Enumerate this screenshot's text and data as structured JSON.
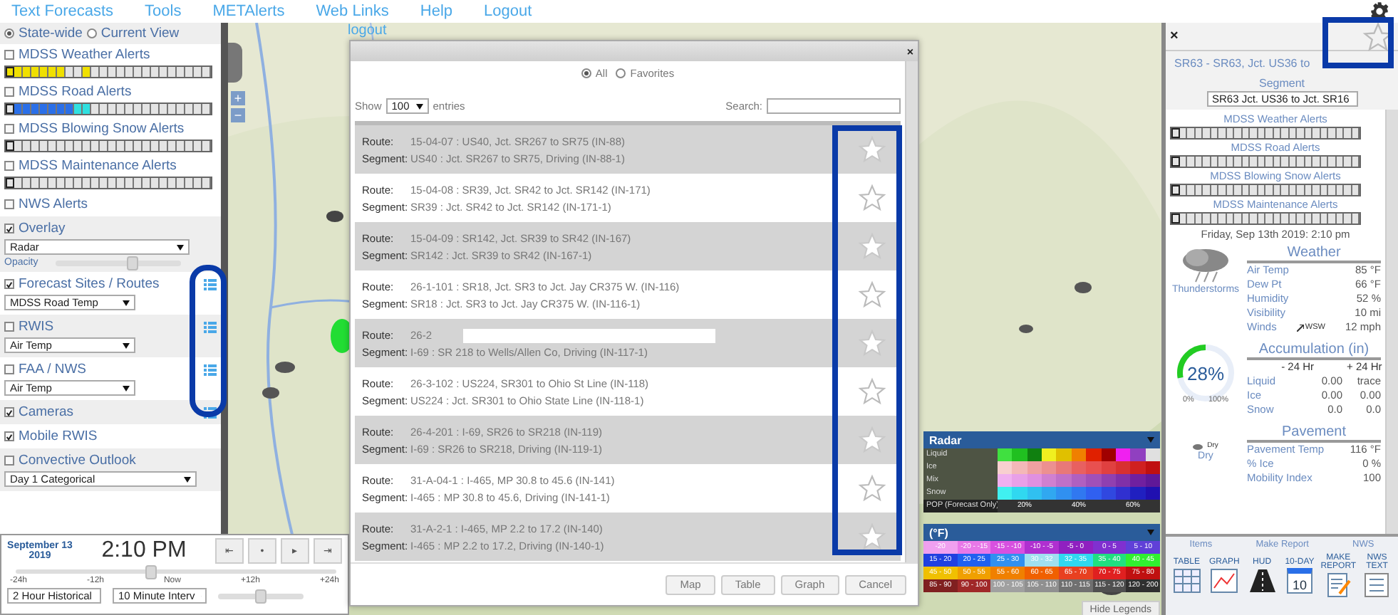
{
  "nav": {
    "links": [
      "Text Forecasts",
      "Tools",
      "METAlerts",
      "Web Links",
      "Help",
      "Logout"
    ]
  },
  "left_panel": {
    "scope": [
      {
        "label": "State-wide",
        "selected": true
      },
      {
        "label": "Current View",
        "selected": false
      }
    ],
    "alerts": [
      {
        "label": "MDSS Weather Alerts",
        "checked": false,
        "cells": [
          {
            "color": "#f0e000"
          },
          {
            "color": "#f0e000"
          },
          {
            "color": "#f0e000"
          },
          {
            "color": "#f0e000"
          },
          {
            "color": "#f0e000"
          },
          {
            "color": "#f0e000"
          },
          {
            "color": "#f0e000"
          },
          {
            "color": "#e4e4e4"
          },
          {
            "color": "#e4e4e4"
          },
          {
            "color": "#f0e000"
          },
          {
            "color": "#e4e4e4"
          },
          {
            "color": "#e4e4e4"
          },
          {
            "color": "#e4e4e4"
          },
          {
            "color": "#e4e4e4"
          },
          {
            "color": "#e4e4e4"
          },
          {
            "color": "#e4e4e4"
          },
          {
            "color": "#e4e4e4"
          },
          {
            "color": "#e4e4e4"
          },
          {
            "color": "#e4e4e4"
          },
          {
            "color": "#e4e4e4"
          },
          {
            "color": "#e4e4e4"
          },
          {
            "color": "#e4e4e4"
          },
          {
            "color": "#e4e4e4"
          },
          {
            "color": "#e4e4e4"
          }
        ]
      },
      {
        "label": "MDSS Road Alerts",
        "checked": false,
        "cells": [
          {
            "color": "#e4e4e4"
          },
          {
            "color": "#2a6fe8"
          },
          {
            "color": "#2a6fe8"
          },
          {
            "color": "#2a6fe8"
          },
          {
            "color": "#2a6fe8"
          },
          {
            "color": "#2a6fe8"
          },
          {
            "color": "#2a6fe8"
          },
          {
            "color": "#2a6fe8"
          },
          {
            "color": "#30e0e0"
          },
          {
            "color": "#30e0e0"
          },
          {
            "color": "#e4e4e4"
          },
          {
            "color": "#e4e4e4"
          },
          {
            "color": "#e4e4e4"
          },
          {
            "color": "#e4e4e4"
          },
          {
            "color": "#e4e4e4"
          },
          {
            "color": "#e4e4e4"
          },
          {
            "color": "#e4e4e4"
          },
          {
            "color": "#e4e4e4"
          },
          {
            "color": "#e4e4e4"
          },
          {
            "color": "#e4e4e4"
          },
          {
            "color": "#e4e4e4"
          },
          {
            "color": "#e4e4e4"
          },
          {
            "color": "#e4e4e4"
          },
          {
            "color": "#e4e4e4"
          }
        ]
      },
      {
        "label": "MDSS Blowing Snow Alerts",
        "checked": false,
        "cells": [
          {
            "color": "#e4e4e4"
          },
          {
            "color": "#e4e4e4"
          },
          {
            "color": "#e4e4e4"
          },
          {
            "color": "#e4e4e4"
          },
          {
            "color": "#e4e4e4"
          },
          {
            "color": "#e4e4e4"
          },
          {
            "color": "#e4e4e4"
          },
          {
            "color": "#e4e4e4"
          },
          {
            "color": "#e4e4e4"
          },
          {
            "color": "#e4e4e4"
          },
          {
            "color": "#e4e4e4"
          },
          {
            "color": "#e4e4e4"
          },
          {
            "color": "#e4e4e4"
          },
          {
            "color": "#e4e4e4"
          },
          {
            "color": "#e4e4e4"
          },
          {
            "color": "#e4e4e4"
          },
          {
            "color": "#e4e4e4"
          },
          {
            "color": "#e4e4e4"
          },
          {
            "color": "#e4e4e4"
          },
          {
            "color": "#e4e4e4"
          },
          {
            "color": "#e4e4e4"
          },
          {
            "color": "#e4e4e4"
          },
          {
            "color": "#e4e4e4"
          },
          {
            "color": "#e4e4e4"
          }
        ]
      },
      {
        "label": "MDSS Maintenance Alerts",
        "checked": false,
        "cells": [
          {
            "color": "#e4e4e4"
          },
          {
            "color": "#e4e4e4"
          },
          {
            "color": "#e4e4e4"
          },
          {
            "color": "#e4e4e4"
          },
          {
            "color": "#e4e4e4"
          },
          {
            "color": "#e4e4e4"
          },
          {
            "color": "#e4e4e4"
          },
          {
            "color": "#e4e4e4"
          },
          {
            "color": "#e4e4e4"
          },
          {
            "color": "#e4e4e4"
          },
          {
            "color": "#e4e4e4"
          },
          {
            "color": "#e4e4e4"
          },
          {
            "color": "#e4e4e4"
          },
          {
            "color": "#e4e4e4"
          },
          {
            "color": "#e4e4e4"
          },
          {
            "color": "#e4e4e4"
          },
          {
            "color": "#e4e4e4"
          },
          {
            "color": "#e4e4e4"
          },
          {
            "color": "#e4e4e4"
          },
          {
            "color": "#e4e4e4"
          },
          {
            "color": "#e4e4e4"
          },
          {
            "color": "#e4e4e4"
          },
          {
            "color": "#e4e4e4"
          },
          {
            "color": "#e4e4e4"
          }
        ]
      }
    ],
    "layers": [
      {
        "kind": "check",
        "label": "NWS Alerts",
        "checked": false,
        "list": false
      },
      {
        "kind": "overlay",
        "label": "Overlay",
        "checked": true,
        "select": "Radar",
        "opacity_label": "Opacity",
        "level": 0.62,
        "list": false
      },
      {
        "kind": "select",
        "label": "Forecast Sites / Routes",
        "checked": true,
        "select": "MDSS Road Temp",
        "list": true
      },
      {
        "kind": "select",
        "label": "RWIS",
        "checked": false,
        "select": "Air Temp",
        "list": true
      },
      {
        "kind": "select",
        "label": "FAA / NWS",
        "checked": false,
        "select": "Air Temp",
        "list": true
      },
      {
        "kind": "check",
        "label": "Cameras",
        "checked": true,
        "list": true
      },
      {
        "kind": "check",
        "label": "Mobile RWIS",
        "checked": true,
        "list": false
      },
      {
        "kind": "wide",
        "label": "Convective Outlook",
        "checked": false,
        "select": "Day 1 Categorical",
        "list": false
      }
    ]
  },
  "map": {
    "logout_text": "logout",
    "zoom": [
      "+",
      "−"
    ]
  },
  "time_panel": {
    "date": "September 13 2019",
    "time": "2:10 PM",
    "controls": [
      "⇤",
      "•",
      "▸",
      "⇥"
    ],
    "ticks": [
      "-24h",
      "-12h",
      "Now",
      "+12h",
      "+24h"
    ],
    "level": 0.42,
    "selects": [
      "2 Hour Historical",
      "10 Minute Interv"
    ],
    "speed": {
      "level": 0.5
    }
  },
  "modal": {
    "filters": [
      {
        "label": "All",
        "selected": true
      },
      {
        "label": "Favorites",
        "selected": false
      }
    ],
    "show_label": "Show",
    "page_size": "100",
    "entries_label": "entries",
    "search_label": "Search:",
    "rows": [
      {
        "route_label": "Route:",
        "route": "15-04-07 : US40, Jct. SR267 to SR75 (IN-88)",
        "segment_label": "Segment:",
        "segment": "US40 : Jct. SR267 to SR75, Driving (IN-88-1)",
        "favorite": true,
        "redacted": false
      },
      {
        "route_label": "Route:",
        "route": "15-04-08 : SR39, Jct. SR42 to Jct. SR142 (IN-171)",
        "segment_label": "Segment:",
        "segment": "SR39 : Jct. SR42 to Jct. SR142 (IN-171-1)",
        "favorite": false,
        "redacted": false
      },
      {
        "route_label": "Route:",
        "route": "15-04-09 : SR142, Jct. SR39 to SR42 (IN-167)",
        "segment_label": "Segment:",
        "segment": "SR142 : Jct. SR39 to SR42 (IN-167-1)",
        "favorite": true,
        "redacted": false
      },
      {
        "route_label": "Route:",
        "route": "26-1-101 : SR18, Jct. SR3 to Jct. Jay CR375 W. (IN-116)",
        "segment_label": "Segment:",
        "segment": "SR18 : Jct. SR3 to Jct. Jay CR375 W. (IN-116-1)",
        "favorite": false,
        "redacted": false
      },
      {
        "route_label": "Route:",
        "route": "26-2",
        "segment_label": "Segment:",
        "segment": "I-69 : SR 218 to Wells/Allen Co, Driving (IN-117-1)",
        "favorite": true,
        "redacted": true
      },
      {
        "route_label": "Route:",
        "route": "26-3-102 : US224, SR301 to Ohio St Line (IN-118)",
        "segment_label": "Segment:",
        "segment": "US224 : Jct. SR301 to Ohio State Line (IN-118-1)",
        "favorite": false,
        "redacted": false
      },
      {
        "route_label": "Route:",
        "route": "26-4-201 : I-69, SR26 to SR218 (IN-119)",
        "segment_label": "Segment:",
        "segment": "I-69 : SR26 to SR218, Driving (IN-119-1)",
        "favorite": true,
        "redacted": false
      },
      {
        "route_label": "Route:",
        "route": "31-A-04-1 : I-465, MP 30.8 to 45.6 (IN-141)",
        "segment_label": "Segment:",
        "segment": "I-465 : MP 30.8 to 45.6, Driving (IN-141-1)",
        "favorite": false,
        "redacted": false
      },
      {
        "route_label": "Route:",
        "route": "31-A-2-1 : I-465, MP 2.2 to 17.2 (IN-140)",
        "segment_label": "Segment:",
        "segment": "I-465 : MP 2.2 to 17.2, Driving (IN-140-1)",
        "favorite": true,
        "redacted": false
      }
    ],
    "buttons": [
      "Map",
      "Table",
      "Graph",
      "Cancel"
    ]
  },
  "legend": {
    "radar_title": "Radar",
    "radar_rows": [
      {
        "label": "Liquid",
        "colors": [
          {
            "color": "#40e040"
          },
          {
            "color": "#20c020"
          },
          {
            "color": "#108010"
          },
          {
            "color": "#f0f020"
          },
          {
            "color": "#e0c000"
          },
          {
            "color": "#f08000"
          },
          {
            "color": "#e02000"
          },
          {
            "color": "#a00000"
          },
          {
            "color": "#f020f0"
          },
          {
            "color": "#9040c0"
          },
          {
            "color": "#e0e0e0"
          }
        ]
      },
      {
        "label": "Ice",
        "colors": [
          {
            "color": "#f8d0d0"
          },
          {
            "color": "#f4b8b8"
          },
          {
            "color": "#f0a0a0"
          },
          {
            "color": "#ec9090"
          },
          {
            "color": "#e87878"
          },
          {
            "color": "#e86060"
          },
          {
            "color": "#e85050"
          },
          {
            "color": "#e04040"
          },
          {
            "color": "#d83030"
          },
          {
            "color": "#d02020"
          },
          {
            "color": "#c01010"
          }
        ]
      },
      {
        "label": "Mix",
        "colors": [
          {
            "color": "#f0b0f0"
          },
          {
            "color": "#e8a0e8"
          },
          {
            "color": "#e090e0"
          },
          {
            "color": "#d080d0"
          },
          {
            "color": "#c070c8"
          },
          {
            "color": "#b060c0"
          },
          {
            "color": "#a050b8"
          },
          {
            "color": "#9040b0"
          },
          {
            "color": "#8030a8"
          },
          {
            "color": "#7020a0"
          },
          {
            "color": "#601898"
          }
        ]
      },
      {
        "label": "Snow",
        "colors": [
          {
            "color": "#40f0f0"
          },
          {
            "color": "#30d8f0"
          },
          {
            "color": "#30c0f0"
          },
          {
            "color": "#30a8f0"
          },
          {
            "color": "#3090f0"
          },
          {
            "color": "#3078f0"
          },
          {
            "color": "#3060f0"
          },
          {
            "color": "#3048e0"
          },
          {
            "color": "#3030d0"
          },
          {
            "color": "#2020c0"
          },
          {
            "color": "#2010b0"
          }
        ]
      }
    ],
    "pop_label": "POP (Forecast Only)",
    "pop_values": [
      "20%",
      "40%",
      "60%"
    ],
    "temp_title": "(°F)",
    "temp_rows": [
      [
        {
          "label": "-20",
          "color": "#f0a0f0"
        },
        {
          "label": "-20 - -15",
          "color": "#e878e8"
        },
        {
          "label": "-15 - -10",
          "color": "#d850e0"
        },
        {
          "label": "-10 - -5",
          "color": "#b030d0"
        },
        {
          "label": "-5 - 0",
          "color": "#9020c0"
        },
        {
          "label": "0 - 5",
          "color": "#8030d0"
        },
        {
          "label": "5 - 10",
          "color": "#6040d8"
        }
      ],
      [
        {
          "label": "15 - 20",
          "color": "#2040e0"
        },
        {
          "label": "20 - 25",
          "color": "#2060f0"
        },
        {
          "label": "25 - 30",
          "color": "#3090f0"
        },
        {
          "label": "30 - 32",
          "color": "#a0e0f0"
        },
        {
          "label": "32 - 35",
          "color": "#30d8f0"
        },
        {
          "label": "35 - 40",
          "color": "#20e080"
        },
        {
          "label": "40 - 45",
          "color": "#30f030"
        }
      ],
      [
        {
          "label": "45 - 50",
          "color": "#f0c000"
        },
        {
          "label": "50 - 55",
          "color": "#f0a000"
        },
        {
          "label": "55 - 60",
          "color": "#f08000"
        },
        {
          "label": "60 - 65",
          "color": "#f06000"
        },
        {
          "label": "65 - 70",
          "color": "#e84020"
        },
        {
          "label": "70 - 75",
          "color": "#e02020"
        },
        {
          "label": "75 - 80",
          "color": "#c01010"
        }
      ],
      [
        {
          "label": "85 - 90",
          "color": "#802020"
        },
        {
          "label": "90 - 100",
          "color": "#a02828"
        },
        {
          "label": "100 - 105",
          "color": "#a0a0a0"
        },
        {
          "label": "105 - 110",
          "color": "#909090"
        },
        {
          "label": "110 - 115",
          "color": "#707070"
        },
        {
          "label": "115 - 120",
          "color": "#505050"
        },
        {
          "label": "120 - 200",
          "color": "#303030"
        }
      ]
    ],
    "hide_button": "Hide Legends"
  },
  "right_panel": {
    "close": "×",
    "favorite": false,
    "title": "SR63 - SR63, Jct. US36 to",
    "segment_label": "Segment",
    "segment_select": "SR63 Jct. US36 to Jct. SR16",
    "alerts": [
      {
        "label": "MDSS Weather Alerts",
        "cells": [
          {
            "color": "#e4e4e4"
          },
          {
            "color": "#e4e4e4"
          },
          {
            "color": "#e4e4e4"
          },
          {
            "color": "#e4e4e4"
          },
          {
            "color": "#e4e4e4"
          },
          {
            "color": "#e4e4e4"
          },
          {
            "color": "#e4e4e4"
          },
          {
            "color": "#e4e4e4"
          },
          {
            "color": "#e4e4e4"
          },
          {
            "color": "#e4e4e4"
          },
          {
            "color": "#e4e4e4"
          },
          {
            "color": "#e4e4e4"
          },
          {
            "color": "#e4e4e4"
          },
          {
            "color": "#e4e4e4"
          },
          {
            "color": "#e4e4e4"
          },
          {
            "color": "#e4e4e4"
          },
          {
            "color": "#e4e4e4"
          },
          {
            "color": "#e4e4e4"
          },
          {
            "color": "#e4e4e4"
          },
          {
            "color": "#e4e4e4"
          },
          {
            "color": "#e4e4e4"
          },
          {
            "color": "#e4e4e4"
          },
          {
            "color": "#e4e4e4"
          },
          {
            "color": "#e4e4e4"
          }
        ]
      },
      {
        "label": "MDSS Road Alerts",
        "cells": [
          {
            "color": "#e4e4e4"
          },
          {
            "color": "#e4e4e4"
          },
          {
            "color": "#e4e4e4"
          },
          {
            "color": "#e4e4e4"
          },
          {
            "color": "#e4e4e4"
          },
          {
            "color": "#e4e4e4"
          },
          {
            "color": "#e4e4e4"
          },
          {
            "color": "#e4e4e4"
          },
          {
            "color": "#e4e4e4"
          },
          {
            "color": "#e4e4e4"
          },
          {
            "color": "#e4e4e4"
          },
          {
            "color": "#e4e4e4"
          },
          {
            "color": "#e4e4e4"
          },
          {
            "color": "#e4e4e4"
          },
          {
            "color": "#e4e4e4"
          },
          {
            "color": "#e4e4e4"
          },
          {
            "color": "#e4e4e4"
          },
          {
            "color": "#e4e4e4"
          },
          {
            "color": "#e4e4e4"
          },
          {
            "color": "#e4e4e4"
          },
          {
            "color": "#e4e4e4"
          },
          {
            "color": "#e4e4e4"
          },
          {
            "color": "#e4e4e4"
          },
          {
            "color": "#e4e4e4"
          }
        ]
      },
      {
        "label": "MDSS Blowing Snow Alerts",
        "cells": [
          {
            "color": "#e4e4e4"
          },
          {
            "color": "#e4e4e4"
          },
          {
            "color": "#e4e4e4"
          },
          {
            "color": "#e4e4e4"
          },
          {
            "color": "#e4e4e4"
          },
          {
            "color": "#e4e4e4"
          },
          {
            "color": "#e4e4e4"
          },
          {
            "color": "#e4e4e4"
          },
          {
            "color": "#e4e4e4"
          },
          {
            "color": "#e4e4e4"
          },
          {
            "color": "#e4e4e4"
          },
          {
            "color": "#e4e4e4"
          },
          {
            "color": "#e4e4e4"
          },
          {
            "color": "#e4e4e4"
          },
          {
            "color": "#e4e4e4"
          },
          {
            "color": "#e4e4e4"
          },
          {
            "color": "#e4e4e4"
          },
          {
            "color": "#e4e4e4"
          },
          {
            "color": "#e4e4e4"
          },
          {
            "color": "#e4e4e4"
          },
          {
            "color": "#e4e4e4"
          },
          {
            "color": "#e4e4e4"
          },
          {
            "color": "#e4e4e4"
          },
          {
            "color": "#e4e4e4"
          }
        ]
      },
      {
        "label": "MDSS Maintenance Alerts",
        "cells": [
          {
            "color": "#e4e4e4"
          },
          {
            "color": "#e4e4e4"
          },
          {
            "color": "#e4e4e4"
          },
          {
            "color": "#e4e4e4"
          },
          {
            "color": "#e4e4e4"
          },
          {
            "color": "#e4e4e4"
          },
          {
            "color": "#e4e4e4"
          },
          {
            "color": "#e4e4e4"
          },
          {
            "color": "#e4e4e4"
          },
          {
            "color": "#e4e4e4"
          },
          {
            "color": "#e4e4e4"
          },
          {
            "color": "#e4e4e4"
          },
          {
            "color": "#e4e4e4"
          },
          {
            "color": "#e4e4e4"
          },
          {
            "color": "#e4e4e4"
          },
          {
            "color": "#e4e4e4"
          },
          {
            "color": "#e4e4e4"
          },
          {
            "color": "#e4e4e4"
          },
          {
            "color": "#e4e4e4"
          },
          {
            "color": "#e4e4e4"
          },
          {
            "color": "#e4e4e4"
          },
          {
            "color": "#e4e4e4"
          },
          {
            "color": "#e4e4e4"
          },
          {
            "color": "#e4e4e4"
          }
        ]
      }
    ],
    "datetime": "Friday, Sep 13th 2019: 2:10 pm",
    "condition": "Thunderstorms",
    "weather": {
      "title": "Weather",
      "rows": [
        {
          "label": "Air Temp",
          "value": "85 °F"
        },
        {
          "label": "Dew Pt",
          "value": "66 °F"
        },
        {
          "label": "Humidity",
          "value": "52 %"
        },
        {
          "label": "Visibility",
          "value": "10 mi"
        },
        {
          "label": "Winds",
          "direction": "WSW",
          "value": "12 mph"
        }
      ]
    },
    "gauge": {
      "reading": "28%",
      "level": 0.28,
      "min": "0%",
      "max": "100%"
    },
    "accumulation": {
      "title": "Accumulation (in)",
      "columns": [
        "- 24 Hr",
        "+ 24 Hr"
      ],
      "rows": [
        {
          "label": "Liquid",
          "values": [
            "0.00",
            "trace"
          ]
        },
        {
          "label": "Ice",
          "values": [
            "0.00",
            "0.00"
          ]
        },
        {
          "label": "Snow",
          "values": [
            "0.0",
            "0.0"
          ]
        }
      ]
    },
    "pavement": {
      "title": "Pavement",
      "icon_label": "Dry",
      "state": "Dry",
      "rows": [
        {
          "label": "Pavement Temp",
          "value": "116 °F"
        },
        {
          "label": "% Ice",
          "value": "0 %"
        },
        {
          "label": "Mobility Index",
          "value": "100"
        }
      ]
    },
    "toolbar": {
      "groups": [
        "Items",
        "Make Report",
        "NWS"
      ],
      "tools": [
        {
          "kind": "table",
          "label": "TABLE"
        },
        {
          "kind": "graph",
          "label": "GRAPH"
        },
        {
          "kind": "hud",
          "label": "HUD"
        },
        {
          "kind": "calendar",
          "label": "10-DAY",
          "day": "10"
        },
        {
          "kind": "report",
          "label": "MAKE REPORT"
        },
        {
          "kind": "list",
          "label": "NWS TEXT"
        }
      ]
    }
  }
}
